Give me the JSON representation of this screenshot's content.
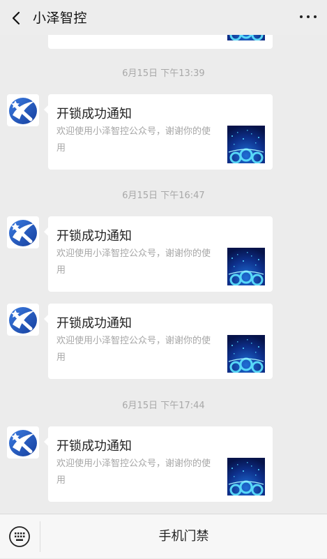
{
  "header": {
    "title": "小泽智控",
    "back_icon": "chevron-left-icon",
    "more_icon": "more-dots-icon"
  },
  "messages": [
    {
      "time": "6月15日 下午13:39",
      "card_title": "开锁成功通知",
      "card_desc": "欢迎使用小泽智控公众号，谢谢你的使用"
    },
    {
      "time": "6月15日 下午16:47",
      "card_title": "开锁成功通知",
      "card_desc": "欢迎使用小泽智控公众号，谢谢你的使用"
    },
    {
      "card_title": "开锁成功通知",
      "card_desc": "欢迎使用小泽智控公众号，谢谢你的使用"
    },
    {
      "time": "6月15日 下午17:44",
      "card_title": "开锁成功通知",
      "card_desc": "欢迎使用小泽智控公众号，谢谢你的使用"
    }
  ],
  "footer": {
    "keyboard_icon": "keyboard-icon",
    "menu_label": "手机门禁"
  },
  "colors": {
    "background": "#ececec",
    "card": "#ffffff",
    "timestamp_text": "#a8a8a8",
    "logo_blue": "#1f4fb8"
  }
}
